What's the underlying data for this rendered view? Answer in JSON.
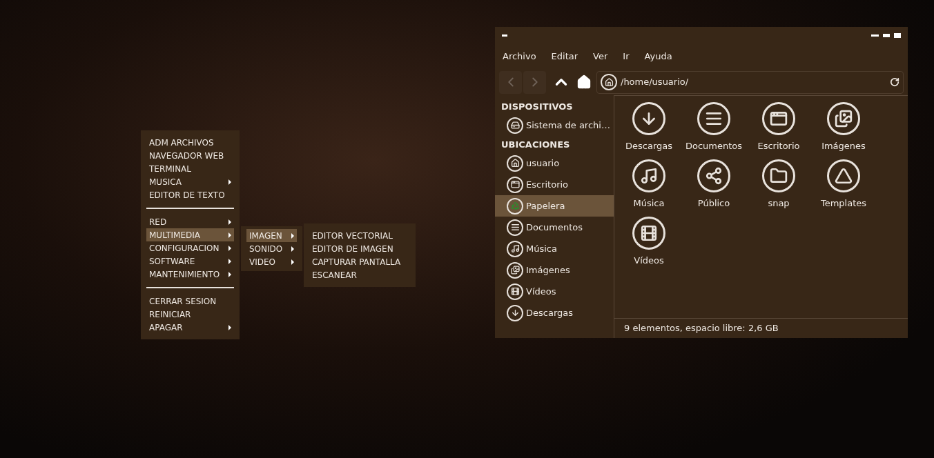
{
  "start_menu": {
    "sections": [
      [
        {
          "label": "ADM ARCHIVOS",
          "submenu": false,
          "selected": false
        },
        {
          "label": "NAVEGADOR WEB",
          "submenu": false,
          "selected": false
        },
        {
          "label": "TERMINAL",
          "submenu": false,
          "selected": false
        },
        {
          "label": "MUSICA",
          "submenu": true,
          "selected": false
        },
        {
          "label": "EDITOR DE TEXTO",
          "submenu": false,
          "selected": false
        }
      ],
      [
        {
          "label": "RED",
          "submenu": true,
          "selected": false
        },
        {
          "label": "MULTIMEDIA",
          "submenu": true,
          "selected": true
        },
        {
          "label": "CONFIGURACION",
          "submenu": true,
          "selected": false
        },
        {
          "label": "SOFTWARE",
          "submenu": true,
          "selected": false
        },
        {
          "label": "MANTENIMIENTO",
          "submenu": true,
          "selected": false
        }
      ],
      [
        {
          "label": "CERRAR SESION",
          "submenu": false,
          "selected": false
        },
        {
          "label": "REINICIAR",
          "submenu": false,
          "selected": false
        },
        {
          "label": "APAGAR",
          "submenu": true,
          "selected": false
        }
      ]
    ]
  },
  "multimedia_menu": {
    "items": [
      {
        "label": "IMAGEN",
        "submenu": true,
        "selected": true
      },
      {
        "label": "SONIDO",
        "submenu": true,
        "selected": false
      },
      {
        "label": "VIDEO",
        "submenu": true,
        "selected": false
      }
    ]
  },
  "imagen_menu": {
    "items": [
      {
        "label": "EDITOR VECTORIAL",
        "submenu": false,
        "selected": false
      },
      {
        "label": "EDITOR DE IMAGEN",
        "submenu": false,
        "selected": false
      },
      {
        "label": "CAPTURAR PANTALLA",
        "submenu": false,
        "selected": false
      },
      {
        "label": "ESCANEAR",
        "submenu": false,
        "selected": false
      }
    ]
  },
  "window": {
    "menubar": [
      "Archivo",
      "Editar",
      "Ver",
      "Ir",
      "Ayuda"
    ],
    "toolbar": {
      "back": {
        "disabled": true
      },
      "forward": {
        "disabled": true
      },
      "path": "/home/usuario/"
    },
    "sidebar": [
      {
        "heading": "DISPOSITIVOS",
        "items": [
          {
            "label": "Sistema de archi…",
            "kind": "drive",
            "selected": false
          }
        ]
      },
      {
        "heading": "UBICACIONES",
        "items": [
          {
            "label": "usuario",
            "kind": "home",
            "selected": false
          },
          {
            "label": "Escritorio",
            "kind": "desktop",
            "selected": false
          },
          {
            "label": "Papelera",
            "kind": "trash",
            "selected": true
          },
          {
            "label": "Documentos",
            "kind": "documents",
            "selected": false
          },
          {
            "label": "Música",
            "kind": "music",
            "selected": false
          },
          {
            "label": "Imágenes",
            "kind": "pictures",
            "selected": false
          },
          {
            "label": "Vídeos",
            "kind": "videos",
            "selected": false
          },
          {
            "label": "Descargas",
            "kind": "downloads",
            "selected": false
          }
        ]
      }
    ],
    "files": [
      {
        "label": "Descargas",
        "kind": "downloads"
      },
      {
        "label": "Documentos",
        "kind": "documents"
      },
      {
        "label": "Escritorio",
        "kind": "desktop"
      },
      {
        "label": "Imágenes",
        "kind": "pictures"
      },
      {
        "label": "Música",
        "kind": "music"
      },
      {
        "label": "Público",
        "kind": "share"
      },
      {
        "label": "snap",
        "kind": "folder"
      },
      {
        "label": "Templates",
        "kind": "templates"
      },
      {
        "label": "Vídeos",
        "kind": "videos"
      }
    ],
    "status_bar": "9 elementos, espacio libre: 2,6 GB"
  }
}
